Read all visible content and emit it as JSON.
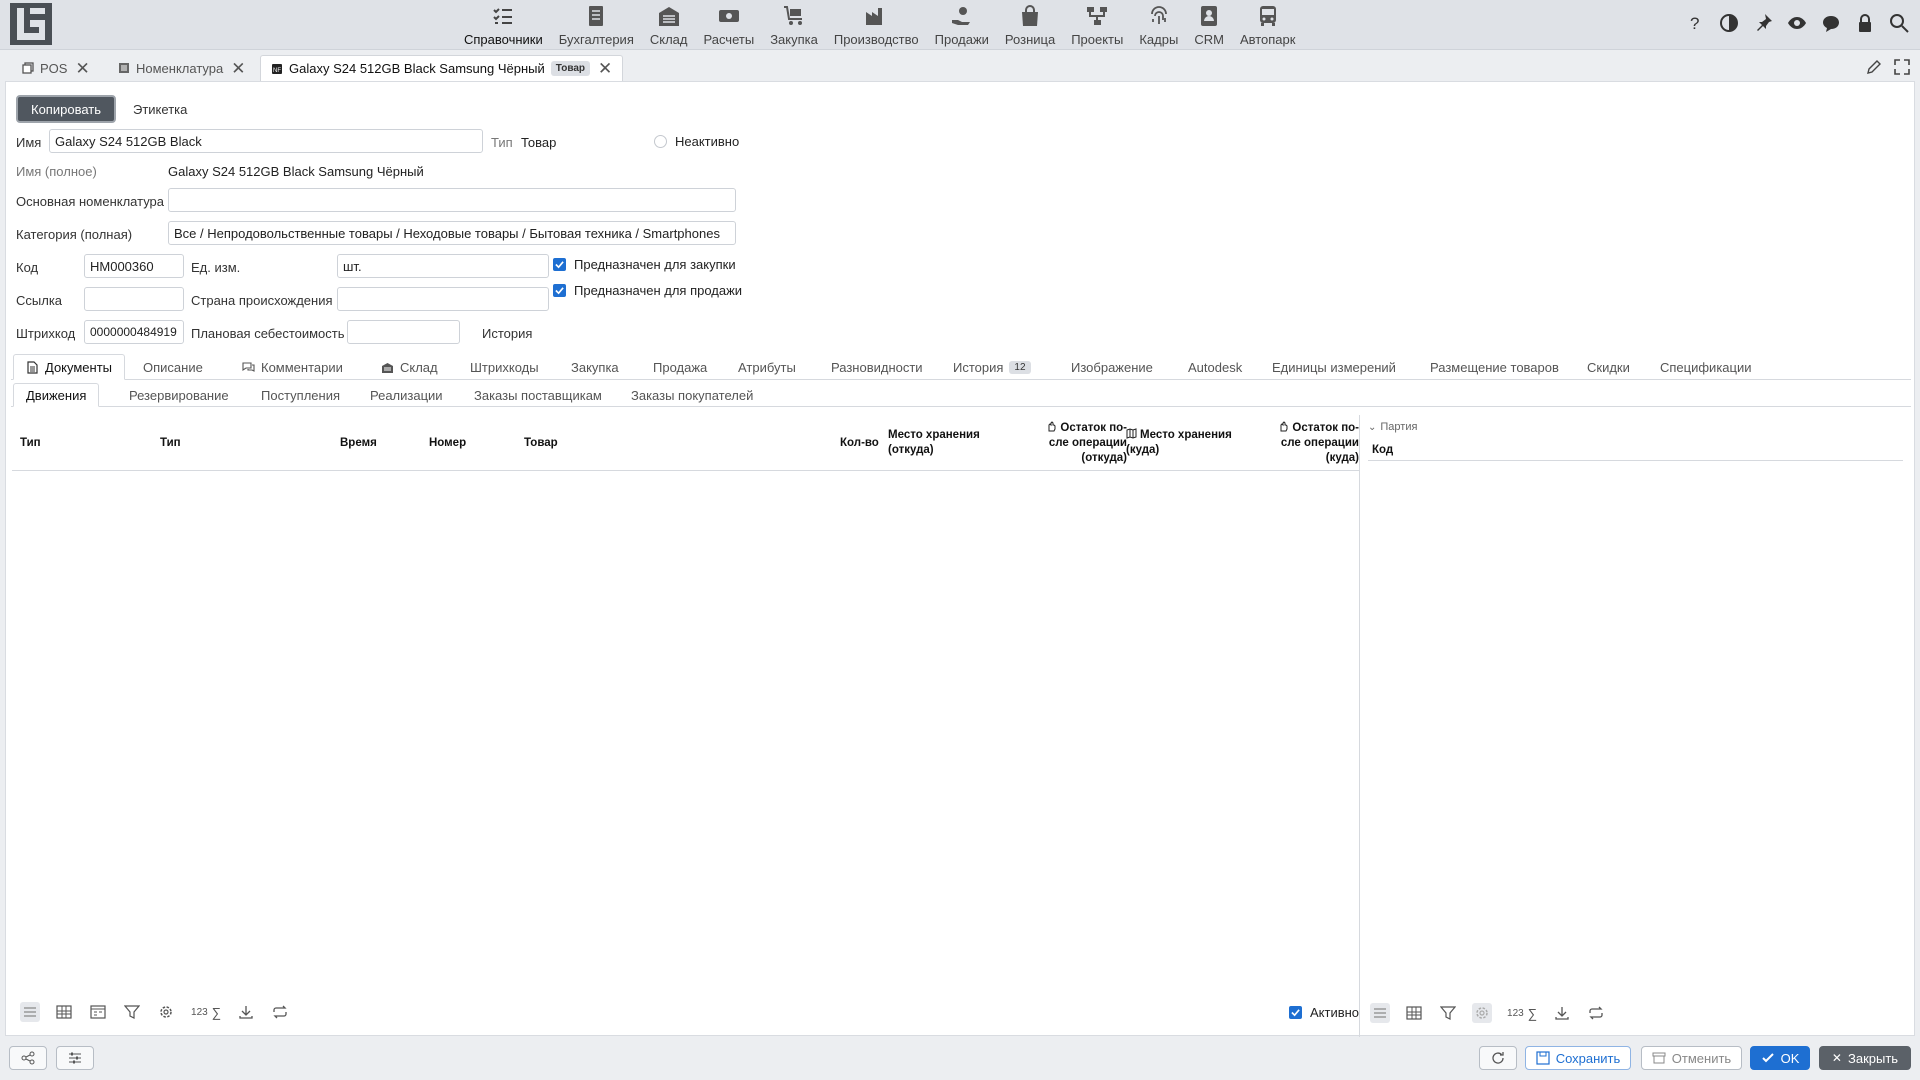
{
  "nav": {
    "modules": [
      {
        "label": "Справочники",
        "icon": "checklist-icon",
        "active": true
      },
      {
        "label": "Бухгалтерия",
        "icon": "ledger-icon"
      },
      {
        "label": "Склад",
        "icon": "warehouse-icon"
      },
      {
        "label": "Расчеты",
        "icon": "money-icon"
      },
      {
        "label": "Закупка",
        "icon": "cart-icon"
      },
      {
        "label": "Производство",
        "icon": "factory-icon"
      },
      {
        "label": "Продажи",
        "icon": "hand-money-icon"
      },
      {
        "label": "Розница",
        "icon": "shopping-bag-icon"
      },
      {
        "label": "Проекты",
        "icon": "project-icon"
      },
      {
        "label": "Кадры",
        "icon": "fingerprint-icon"
      },
      {
        "label": "CRM",
        "icon": "contact-card-icon"
      },
      {
        "label": "Автопарк",
        "icon": "bus-icon"
      }
    ]
  },
  "doc_tabs": [
    {
      "label": "POS",
      "icon": "copy-icon"
    },
    {
      "label": "Номенклатура",
      "icon": "list-icon"
    },
    {
      "label": "Galaxy S24 512GB Black Samsung Чёрный",
      "badge": "Товар",
      "icon": "nft-icon",
      "active": true
    }
  ],
  "toolbar": {
    "copy_label": "Копировать",
    "label_link": "Этикетка"
  },
  "form": {
    "name_label": "Имя",
    "name_value": "Galaxy S24 512GB Black",
    "type_label": "Тип",
    "type_value": "Товар",
    "inactive_label": "Неактивно",
    "fullname_label": "Имя (полное)",
    "fullname_value": "Galaxy S24 512GB Black Samsung Чёрный",
    "base_nom_label": "Основная номенклатура",
    "base_nom_value": "",
    "category_label": "Категория (полная)",
    "category_value": "Все / Непродовольственные товары / Неходовые товары / Бытовая техника / Smartphones",
    "code_label": "Код",
    "code_value": "НМ000360",
    "unit_label": "Ед. изм.",
    "unit_value": "шт.",
    "purchase_label": "Предназначен для закупки",
    "sale_label": "Предназначен для продажи",
    "link_label": "Ссылка",
    "link_value": "",
    "country_label": "Страна происхождения",
    "country_value": "",
    "barcode_label": "Штрихкод",
    "barcode_value": "0000000484919",
    "plan_cost_label": "Плановая себестоимость",
    "plan_cost_value": "",
    "history_link": "История"
  },
  "main_tabs": [
    {
      "label": "Документы",
      "active": true
    },
    {
      "label": "Описание"
    },
    {
      "label": "Комментарии"
    },
    {
      "label": "Склад"
    },
    {
      "label": "Штрихкоды"
    },
    {
      "label": "Закупка"
    },
    {
      "label": "Продажа"
    },
    {
      "label": "Атрибуты"
    },
    {
      "label": "Разновидности"
    },
    {
      "label": "История",
      "count": "12"
    },
    {
      "label": "Изображение"
    },
    {
      "label": "Autodesk"
    },
    {
      "label": "Единицы измерений"
    },
    {
      "label": "Размещение товаров"
    },
    {
      "label": "Скидки"
    },
    {
      "label": "Спецификации"
    }
  ],
  "sub_tabs": [
    "Движения",
    "Резервирование",
    "Поступления",
    "Реализации",
    "Заказы поставщикам",
    "Заказы покупателей"
  ],
  "grid": {
    "columns": [
      "Тип",
      "Тип",
      "Время",
      "Номер",
      "Товар",
      "Кол-во",
      "Место хранения (откуда)",
      "Остаток по-сле операции (откуда)",
      "Место хранения (куда)",
      "Остаток по-сле операции (куда)"
    ],
    "active_label": "Активно",
    "sum_label": "123"
  },
  "right_grid": {
    "group_label": "Партия",
    "columns": [
      "Код"
    ]
  },
  "bottom": {
    "save_label": "Сохранить",
    "cancel_label": "Отменить",
    "ok_label": "OK",
    "close_label": "Закрыть"
  },
  "colors": {
    "primary": "#1e6fd2",
    "dark_button": "#50575f"
  }
}
